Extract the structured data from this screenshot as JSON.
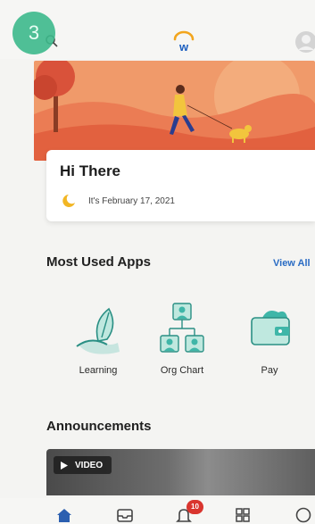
{
  "overlay": {
    "step_number": "3"
  },
  "header": {
    "search_icon": "search-icon",
    "logo_icon": "workday-logo-icon",
    "profile_icon": "profile-icon"
  },
  "greeting": {
    "title": "Hi There",
    "date_text": "It's February 17, 2021",
    "date_icon": "crescent-moon-icon"
  },
  "most_used_apps": {
    "title": "Most Used Apps",
    "view_all_label": "View All",
    "apps": [
      {
        "label": "Learning",
        "icon": "learning-leaf-icon"
      },
      {
        "label": "Org Chart",
        "icon": "org-chart-icon"
      },
      {
        "label": "Pay",
        "icon": "wallet-icon"
      }
    ]
  },
  "announcements": {
    "title": "Announcements",
    "video_badge_label": "VIDEO"
  },
  "bottom_nav": {
    "items": [
      "home-icon",
      "inbox-icon",
      "notifications-bell-icon",
      "apps-grid-icon",
      "profile-icon"
    ],
    "notification_count": "10"
  },
  "colors": {
    "accent_green": "#3dba8c",
    "link_blue": "#2a6cc4",
    "notification_red": "#d9352e",
    "hero_orange": "#e96b4a",
    "app_teal": "#3fb6a8"
  }
}
